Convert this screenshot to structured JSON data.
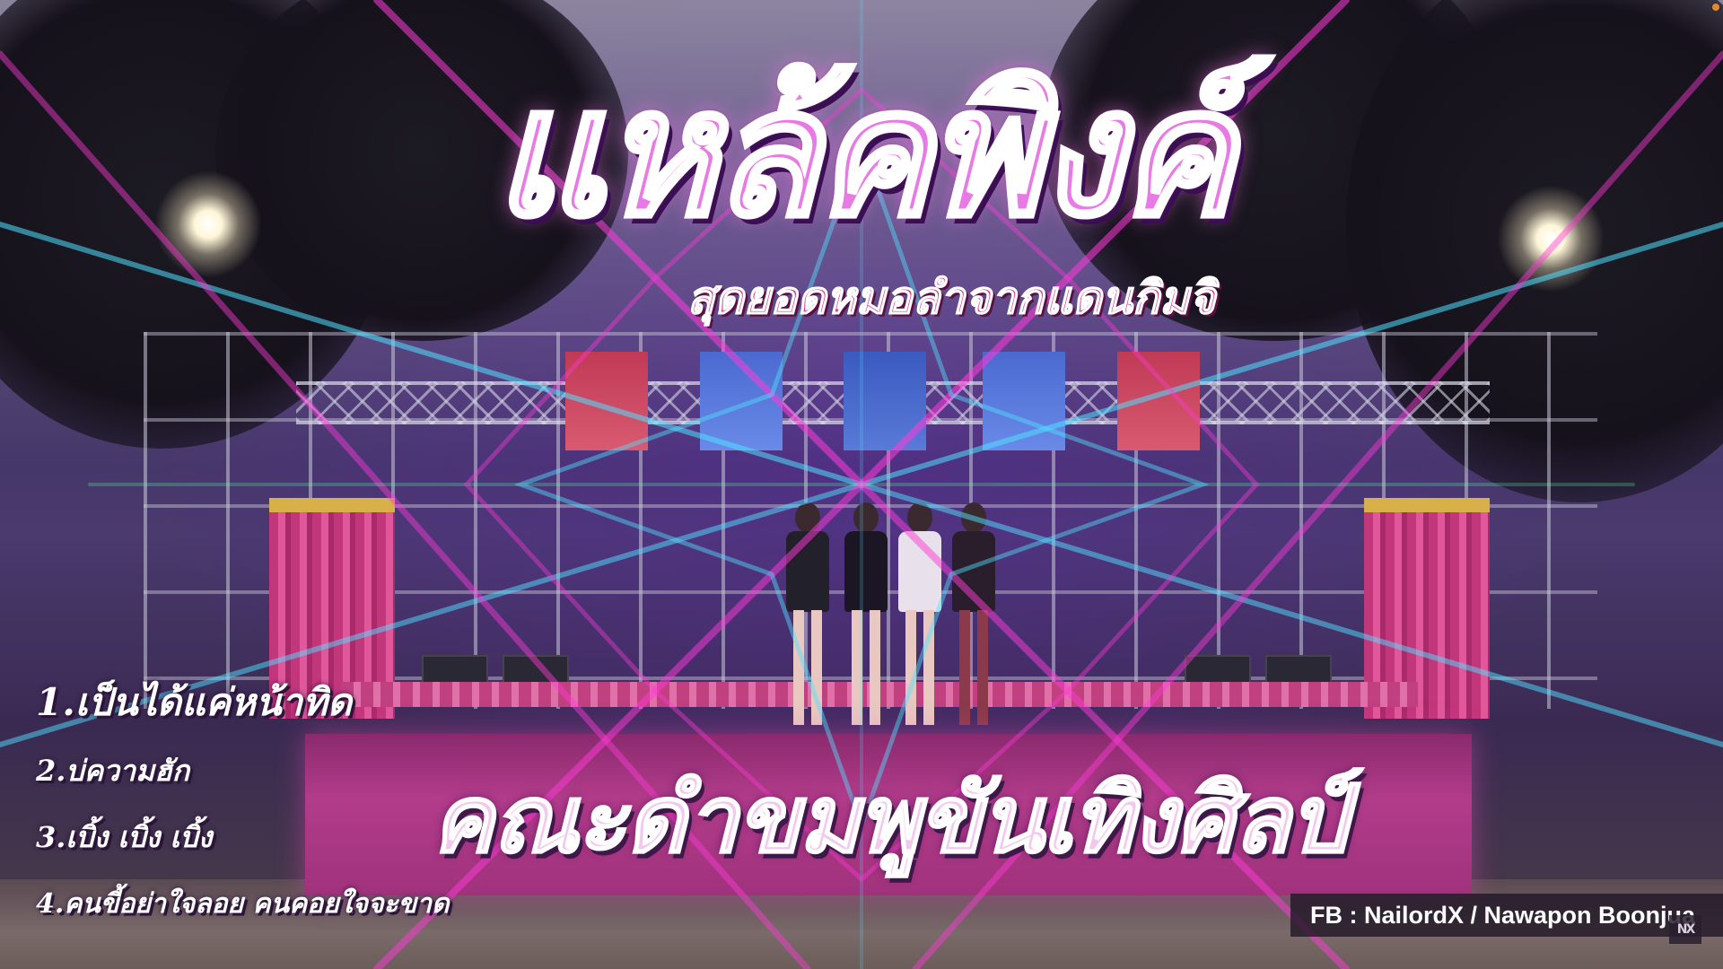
{
  "title": "แหล้คพิงค์",
  "subtitle": "สุดยอดหมอลำจากแดนกิมจิ",
  "banner_text": "คณะดำขมพูขันเทิงศิลป์",
  "playlist": [
    "1.เป็นได้แค่หน้าทิด",
    "2.บ่ความฮัก",
    "3.เบิ้ง เบิ้ง เบิ้ง",
    "4.คนขี้อย่าใจลอย คนคอยใจจะขาด"
  ],
  "credit": "FB : NailordX / Nawapon Boonjua",
  "watermark": "NX",
  "colors": {
    "title_fill": "#e77ae4",
    "subtitle_fill": "#d6409a",
    "laser_cyan": "#4fe0ff",
    "laser_magenta": "#ff3ad8",
    "laser_green": "#5cffa8"
  }
}
